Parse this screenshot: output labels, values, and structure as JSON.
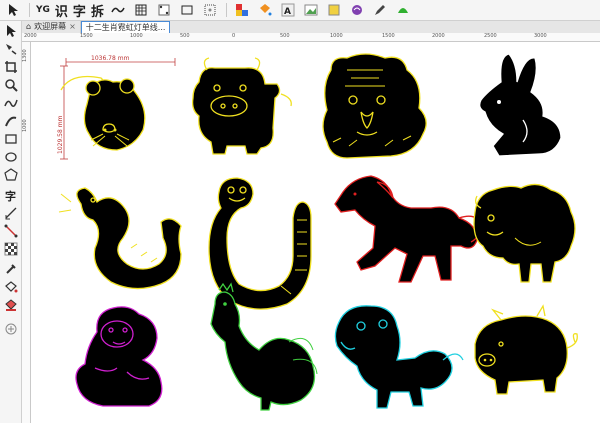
{
  "toolbar": {
    "items": [
      {
        "label": "识",
        "name": "recognize-button"
      },
      {
        "label": "字",
        "name": "text-button"
      },
      {
        "label": "拆",
        "name": "split-button"
      }
    ],
    "yg_label": "YG"
  },
  "tabs": [
    {
      "label": "欢迎屏幕",
      "active": false
    },
    {
      "label": "十二生肖霓虹灯单线...",
      "active": true
    }
  ],
  "ruler": {
    "h_labels": [
      "2000",
      "1500",
      "1000",
      "500",
      "0",
      "500",
      "1000",
      "1500",
      "2000",
      "2500",
      "3000"
    ],
    "v_labels": [
      "1300",
      "1000"
    ]
  },
  "dimensions": {
    "width_text": "1036.78 mm",
    "height_text": "1029.58 mm"
  },
  "colors": {
    "canvas": "#ffffff",
    "silhouette": "#000000",
    "yellow": "#f0e020",
    "white": "#ffffff",
    "red": "#e02020",
    "magenta": "#d020d0",
    "green": "#40d040",
    "cyan": "#20d0e0",
    "dimension": "#b33333"
  },
  "zodiac": [
    {
      "name": "rat",
      "outline": "yellow"
    },
    {
      "name": "ox",
      "outline": "yellow"
    },
    {
      "name": "tiger",
      "outline": "yellow"
    },
    {
      "name": "rabbit",
      "outline": "white"
    },
    {
      "name": "dragon",
      "outline": "yellow"
    },
    {
      "name": "snake",
      "outline": "yellow"
    },
    {
      "name": "horse",
      "outline": "red"
    },
    {
      "name": "goat",
      "outline": "yellow"
    },
    {
      "name": "monkey",
      "outline": "magenta"
    },
    {
      "name": "rooster",
      "outline": "green"
    },
    {
      "name": "dog",
      "outline": "cyan"
    },
    {
      "name": "pig",
      "outline": "yellow"
    }
  ]
}
